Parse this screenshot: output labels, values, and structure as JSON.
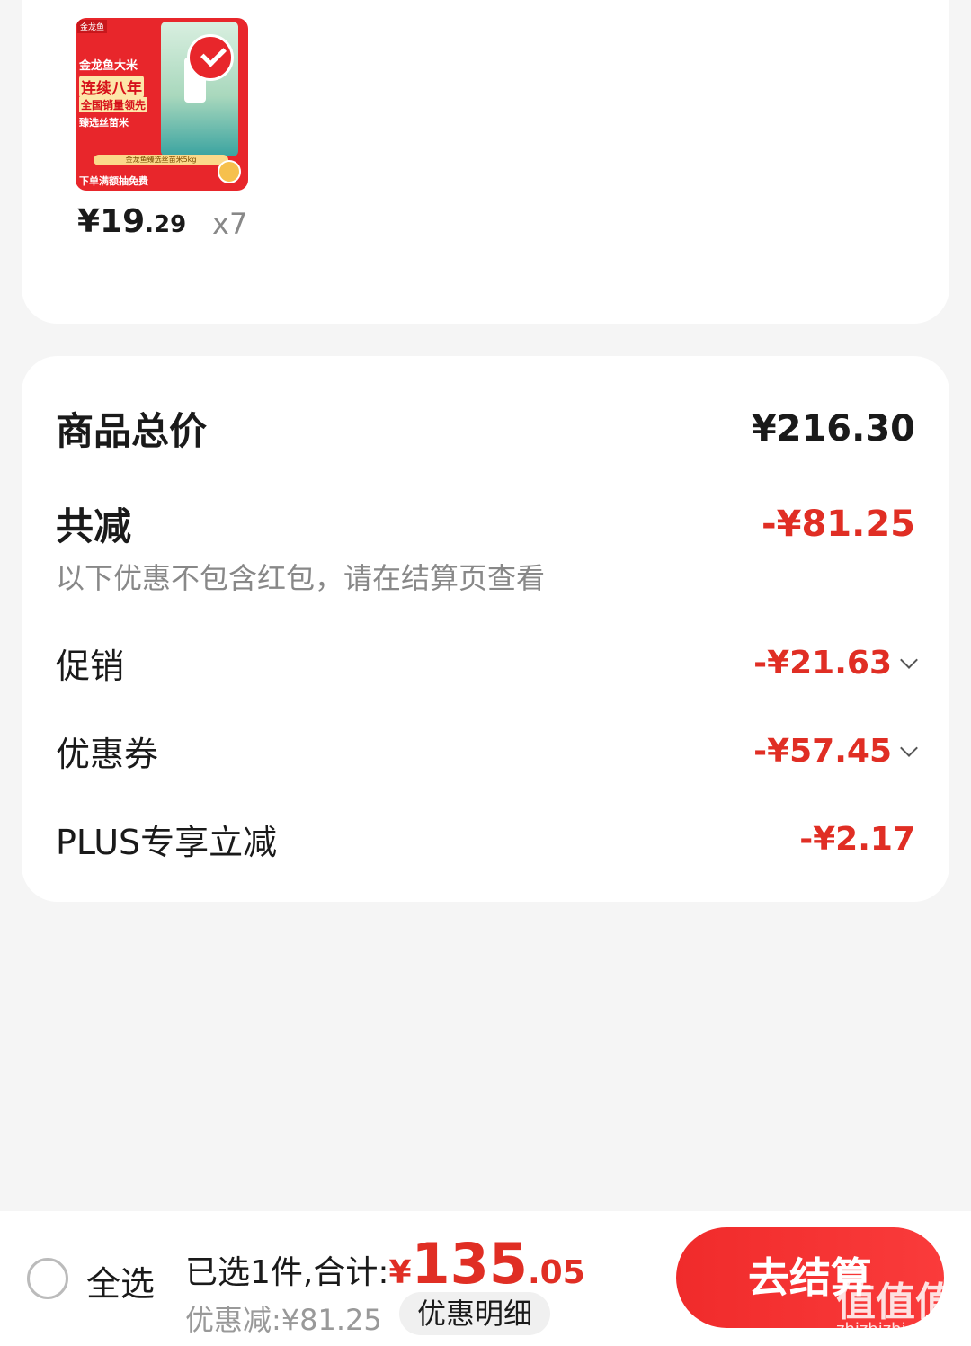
{
  "product": {
    "image_text": {
      "brand_tag": "金龙鱼",
      "line1": "金龙鱼大米",
      "line2": "连续八年",
      "line3": "全国销量领先",
      "line4": "臻选丝苗米",
      "strip": "金龙鱼臻选丝苗米5kg",
      "bottom": "下单满额抽免费"
    },
    "price_symbol": "¥",
    "price_int": "19",
    "price_dec": ".29",
    "quantity": "x7"
  },
  "summary": {
    "total_label": "商品总价",
    "total_value": "¥216.30",
    "reduce_label": "共减",
    "reduce_value": "-¥81.25",
    "note": "以下优惠不包含红包，请在结算页查看",
    "items": [
      {
        "label": "促销",
        "value": "-¥21.63"
      },
      {
        "label": "优惠券",
        "value": "-¥57.45"
      },
      {
        "label": "PLUS专享立减",
        "value": "-¥2.17"
      }
    ]
  },
  "bottom_bar": {
    "select_all": "全选",
    "selected_text": "已选1件,合计:",
    "total_yen": "¥",
    "total_int": "135",
    "total_dec": ".05",
    "discount_text": "优惠减:¥81.25",
    "detail_chip": "优惠明细",
    "checkout": "去结算"
  },
  "watermark": {
    "main": "值值值",
    "sub": "zhizhizhi.com"
  },
  "colors": {
    "accent_red": "#e02e24",
    "button_red": "#f02b2b",
    "background": "#f5f5f5"
  }
}
